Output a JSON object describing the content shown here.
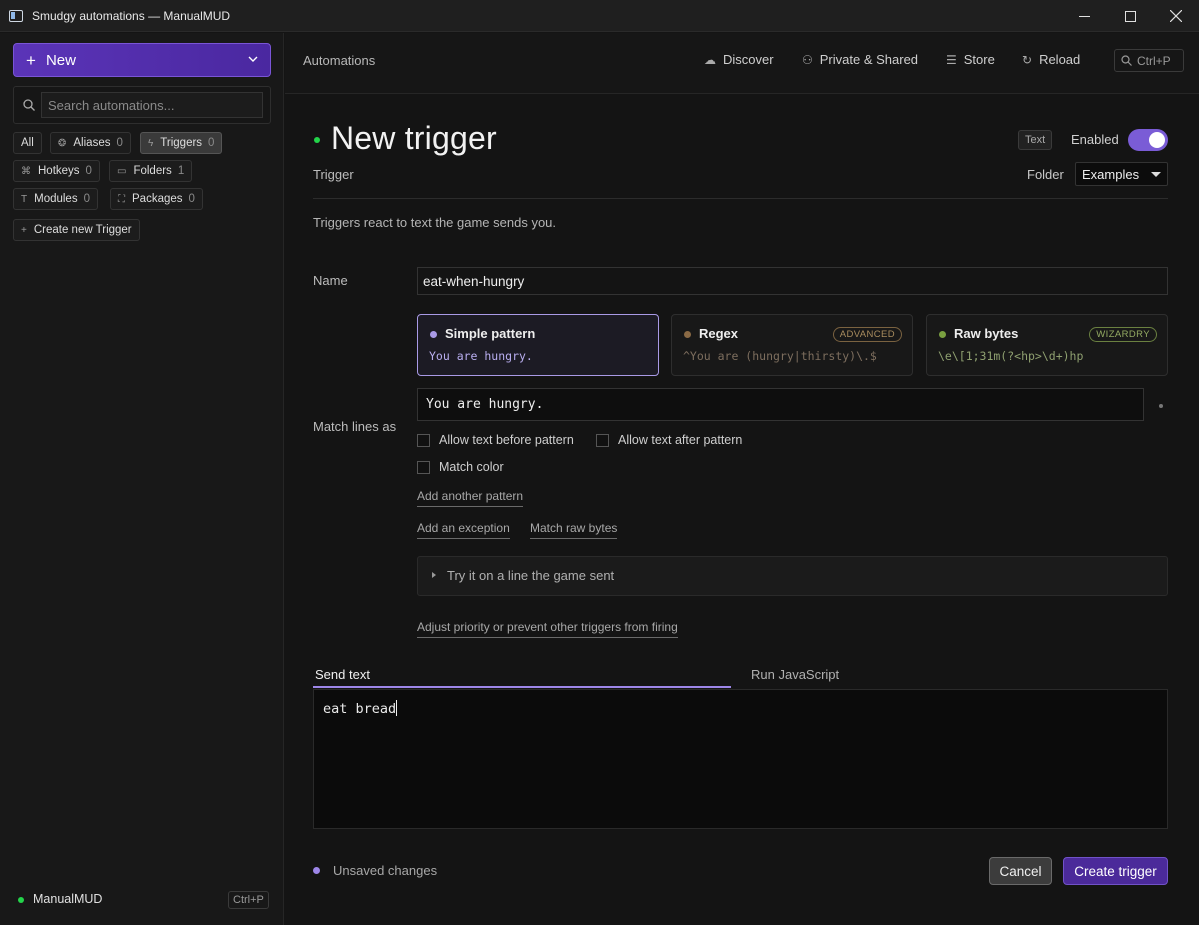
{
  "window": {
    "title": "Smudgy automations — ManualMUD"
  },
  "sidebar": {
    "new_label": "New",
    "search_placeholder": "Search automations...",
    "filters": [
      {
        "label": "All",
        "count": ""
      },
      {
        "label": "Aliases",
        "count": "0"
      },
      {
        "label": "Triggers",
        "count": "0"
      },
      {
        "label": "Hotkeys",
        "count": "0"
      },
      {
        "label": "Folders",
        "count": "1"
      },
      {
        "label": "Modules",
        "count": "0"
      },
      {
        "label": "Packages",
        "count": "0"
      }
    ],
    "create_new_label": "Create new Trigger",
    "footer": {
      "mud_name": "ManualMUD",
      "shortcut": "Ctrl+P"
    }
  },
  "topbar": {
    "breadcrumb": "Automations",
    "nav": [
      "Discover",
      "Private & Shared",
      "Store",
      "Reload"
    ],
    "command_shortcut": "Ctrl+P"
  },
  "main": {
    "title": "New trigger",
    "subtitle": "Trigger",
    "type_badge": "Text",
    "enabled_label": "Enabled",
    "enabled": true,
    "folder_label": "Folder",
    "folder_value": "Examples",
    "description": "Triggers react to text the game sends you.",
    "name_label": "Name",
    "name_value": "eat-when-hungry",
    "pattern_types": [
      {
        "title": "Simple pattern",
        "badge": "",
        "example": "You are hungry.",
        "dot_color": "#a99ae6",
        "example_color": "#b9aef0"
      },
      {
        "title": "Regex",
        "badge": "ADVANCED",
        "example": "^You are (hungry|thirsty)\\.$",
        "dot_color": "#8a6a45",
        "example_color": "#7d6e5e"
      },
      {
        "title": "Raw bytes",
        "badge": "WIZARDRY",
        "example": "\\e\\[1;31m(?<hp>\\d+)hp",
        "dot_color": "#7aa040",
        "example_color": "#8fa070"
      }
    ],
    "match_label": "Match lines as",
    "match_value": "You are hungry.",
    "options": {
      "allow_before": "Allow text before pattern",
      "allow_after": "Allow text after pattern",
      "match_color": "Match color"
    },
    "links": {
      "add_pattern": "Add another pattern",
      "add_exception": "Add an exception",
      "match_raw": "Match raw bytes",
      "priority": "Adjust priority or prevent other triggers from firing"
    },
    "try_label": "Try it on a line the game sent",
    "tabs": [
      "Send text",
      "Run JavaScript"
    ],
    "send_text": "eat bread",
    "unsaved_label": "Unsaved changes",
    "cancel_label": "Cancel",
    "create_label": "Create trigger"
  },
  "colors": {
    "accent": "#7a5cd6",
    "online": "#23d44a"
  }
}
